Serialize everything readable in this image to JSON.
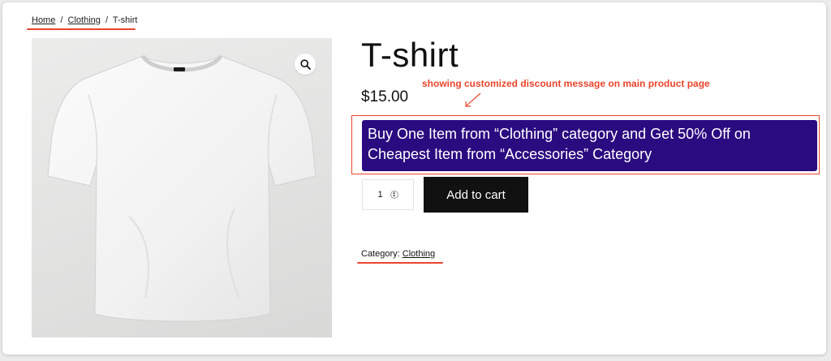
{
  "breadcrumb": {
    "home": "Home",
    "separator": "/",
    "clothing": "Clothing",
    "current": "T-shirt"
  },
  "product": {
    "title": "T-shirt",
    "price": "$15.00",
    "image_alt": "white t-shirt",
    "discount_message": "Buy One Item from “Clothing” category and Get 50% Off on Cheapest Item from “Accessories” Category",
    "quantity": "1",
    "add_to_cart_label": "Add to cart",
    "category_label": "Category:",
    "category_value": "Clothing"
  },
  "annotation": {
    "text": "showing customized discount message on main product page"
  },
  "colors": {
    "discount_bg": "#2b0b80",
    "annotation_red": "#e8452c",
    "button_bg": "#111111"
  },
  "icons": {
    "zoom": "magnifier-icon"
  }
}
